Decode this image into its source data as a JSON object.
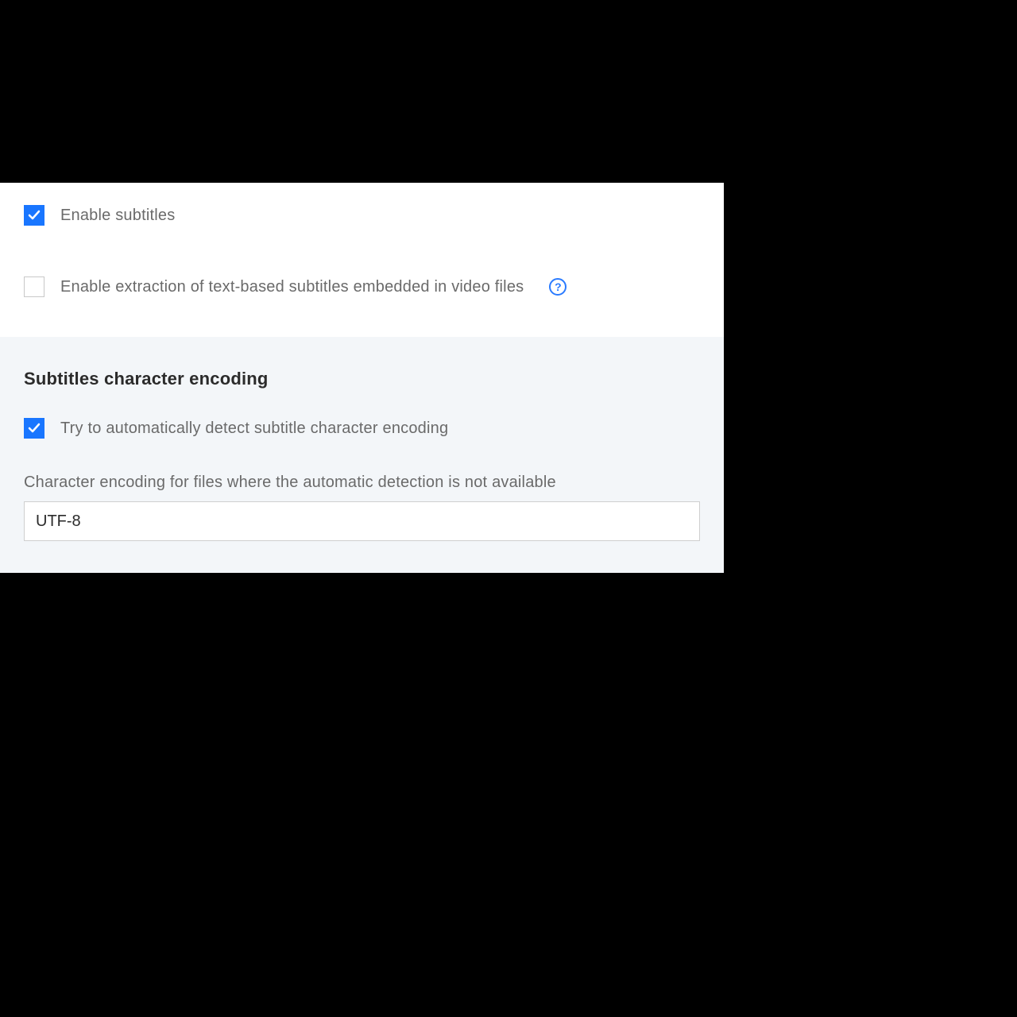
{
  "topSection": {
    "enableSubtitles": {
      "label": "Enable subtitles",
      "checked": true
    },
    "enableExtraction": {
      "label": "Enable extraction of text-based subtitles embedded in video files",
      "checked": false
    }
  },
  "encodingSection": {
    "heading": "Subtitles character encoding",
    "autoDetect": {
      "label": "Try to automatically detect subtitle character encoding",
      "checked": true
    },
    "fallbackLabel": "Character encoding for files where the automatic detection is not available",
    "fallbackValue": "UTF-8"
  },
  "icons": {
    "helpGlyph": "?"
  }
}
